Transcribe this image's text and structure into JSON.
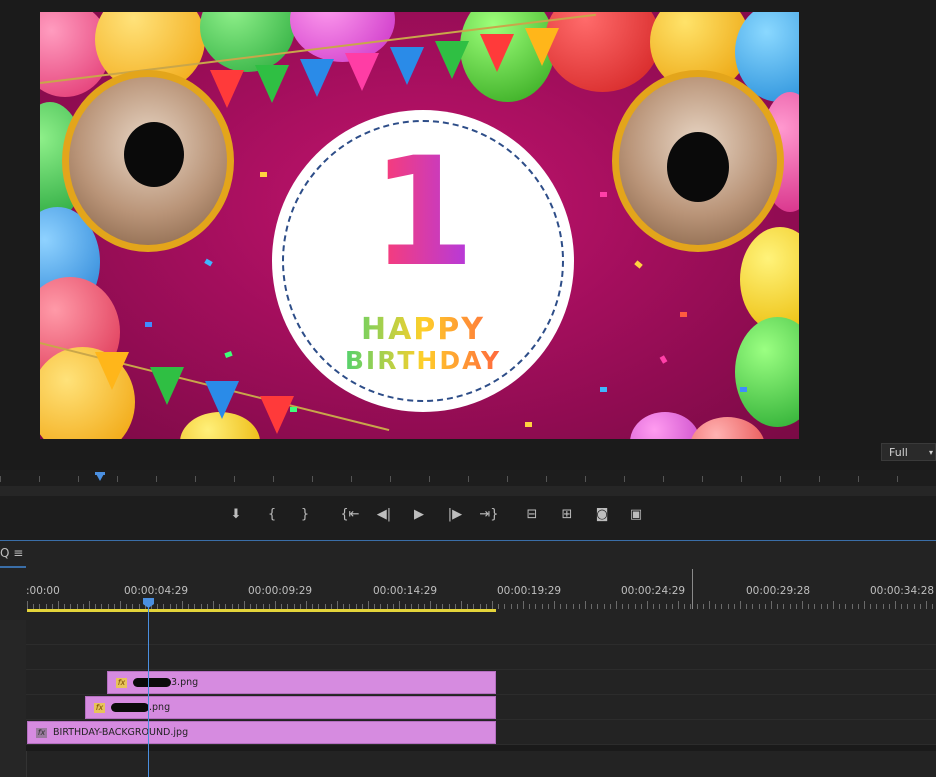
{
  "monitor": {
    "frame_text": {
      "number": "1",
      "line1": "HAPPY",
      "line2": "BIRTHDAY"
    },
    "zoom_select": "Full"
  },
  "transport": {
    "buttons": [
      {
        "name": "add-marker",
        "glyph": "⬇"
      },
      {
        "name": "mark-in",
        "glyph": "{"
      },
      {
        "name": "mark-out",
        "glyph": "}"
      },
      {
        "name": "go-to-in",
        "glyph": "{⇤"
      },
      {
        "name": "step-back",
        "glyph": "◀|"
      },
      {
        "name": "play",
        "glyph": "▶"
      },
      {
        "name": "step-forward",
        "glyph": "|▶"
      },
      {
        "name": "go-to-out",
        "glyph": "⇥}"
      },
      {
        "name": "lift",
        "glyph": "⊟"
      },
      {
        "name": "extract",
        "glyph": "⊞"
      },
      {
        "name": "export-frame",
        "glyph": "◙"
      },
      {
        "name": "compare-view",
        "glyph": "▣"
      }
    ]
  },
  "timeline": {
    "header_icons": "Q ≡",
    "timecodes": [
      ":00:00",
      "00:00:04:29",
      "00:00:09:29",
      "00:00:14:29",
      "00:00:19:29",
      "00:00:24:29",
      "00:00:29:28",
      "00:00:34:28"
    ],
    "clips": {
      "v3": {
        "label_suffix": "3.png"
      },
      "v2": {
        "label_suffix": ".png"
      },
      "v1": {
        "label": "BIRTHDAY-BACKGROUND.jpg"
      }
    },
    "fx_label": "fx"
  },
  "colors": {
    "clip": "#d68be0",
    "playhead": "#4a8fe0",
    "work_area": "#e4d43a",
    "frame_background": "#a20e5c"
  }
}
